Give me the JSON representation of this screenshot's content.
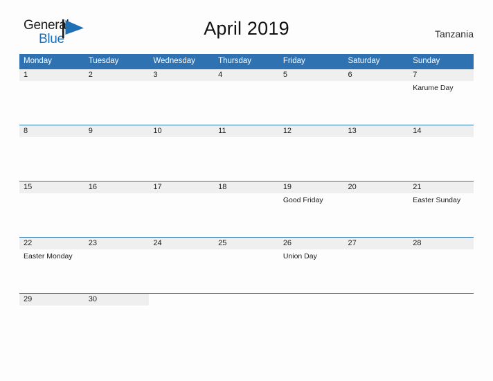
{
  "brand": {
    "name_part1": "General",
    "name_part2": "Blue",
    "accent_color": "#1f6fb5"
  },
  "header": {
    "title": "April 2019",
    "region": "Tanzania"
  },
  "theme": {
    "header_blue": "#2e72b2",
    "daynum_band": "#efefef",
    "page_background": "#fdfdfd"
  },
  "weekday_headers": [
    "Monday",
    "Tuesday",
    "Wednesday",
    "Thursday",
    "Friday",
    "Saturday",
    "Sunday"
  ],
  "weeks": [
    {
      "days": [
        {
          "date": "1",
          "events": []
        },
        {
          "date": "2",
          "events": []
        },
        {
          "date": "3",
          "events": []
        },
        {
          "date": "4",
          "events": []
        },
        {
          "date": "5",
          "events": []
        },
        {
          "date": "6",
          "events": []
        },
        {
          "date": "7",
          "events": [
            "Karume Day"
          ]
        }
      ]
    },
    {
      "days": [
        {
          "date": "8",
          "events": []
        },
        {
          "date": "9",
          "events": []
        },
        {
          "date": "10",
          "events": []
        },
        {
          "date": "11",
          "events": []
        },
        {
          "date": "12",
          "events": []
        },
        {
          "date": "13",
          "events": []
        },
        {
          "date": "14",
          "events": []
        }
      ]
    },
    {
      "days": [
        {
          "date": "15",
          "events": []
        },
        {
          "date": "16",
          "events": []
        },
        {
          "date": "17",
          "events": []
        },
        {
          "date": "18",
          "events": []
        },
        {
          "date": "19",
          "events": [
            "Good Friday"
          ]
        },
        {
          "date": "20",
          "events": []
        },
        {
          "date": "21",
          "events": [
            "Easter Sunday"
          ]
        }
      ]
    },
    {
      "days": [
        {
          "date": "22",
          "events": [
            "Easter Monday"
          ]
        },
        {
          "date": "23",
          "events": []
        },
        {
          "date": "24",
          "events": []
        },
        {
          "date": "25",
          "events": []
        },
        {
          "date": "26",
          "events": [
            "Union Day"
          ]
        },
        {
          "date": "27",
          "events": []
        },
        {
          "date": "28",
          "events": []
        }
      ]
    },
    {
      "short": true,
      "days": [
        {
          "date": "29",
          "events": []
        },
        {
          "date": "30",
          "events": []
        },
        {
          "date": "",
          "events": []
        },
        {
          "date": "",
          "events": []
        },
        {
          "date": "",
          "events": []
        },
        {
          "date": "",
          "events": []
        },
        {
          "date": "",
          "events": []
        }
      ]
    }
  ]
}
